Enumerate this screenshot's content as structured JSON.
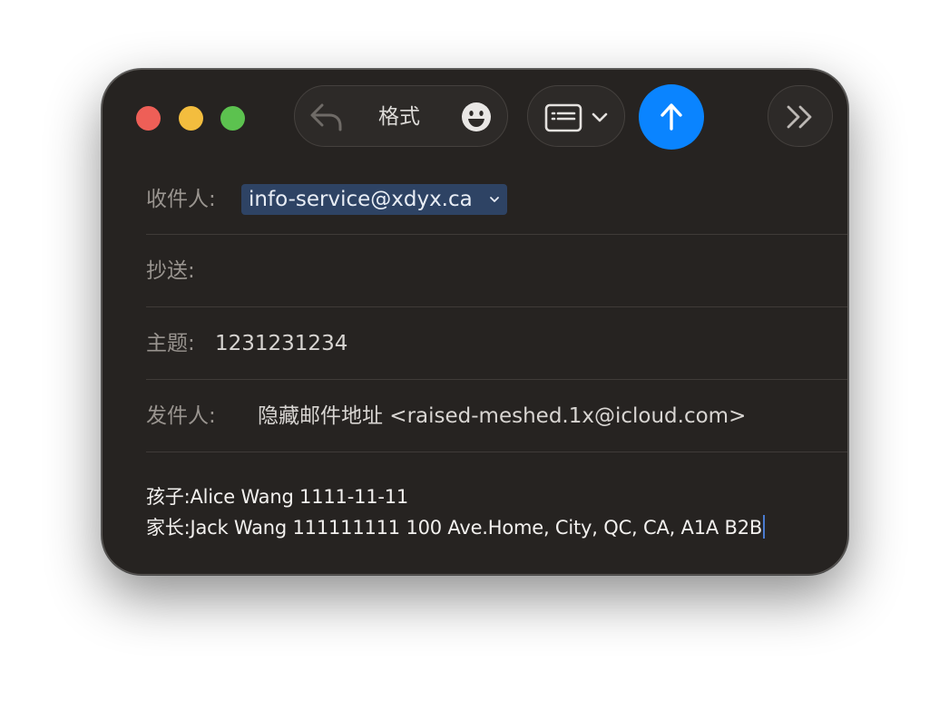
{
  "window": {
    "toolbar": {
      "format_label": "格式"
    },
    "fields": {
      "to_label": "收件人:",
      "to_recipient": "info-service@xdyx.ca",
      "cc_label": "抄送:",
      "subject_label": "主题:",
      "subject_value": "1231231234",
      "from_label": "发件人:",
      "from_value": "隐藏邮件地址 <raised-meshed.1x@icloud.com>"
    },
    "body": {
      "line1": "孩子:Alice Wang 1111-11-11",
      "line2": "家长:Jack Wang 111111111 100 Ave.Home, City, QC, CA, A1A B2B"
    },
    "colors": {
      "send_button": "#0a84ff",
      "close": "#ee5f57",
      "minimize": "#f3bd3e",
      "maximize": "#5cc24f",
      "recipient_token": "#2e4364"
    },
    "icons": [
      "reply-icon",
      "emoji-icon",
      "header-fields-icon",
      "chevron-down-icon",
      "send-arrow-icon",
      "forward-icon"
    ]
  }
}
